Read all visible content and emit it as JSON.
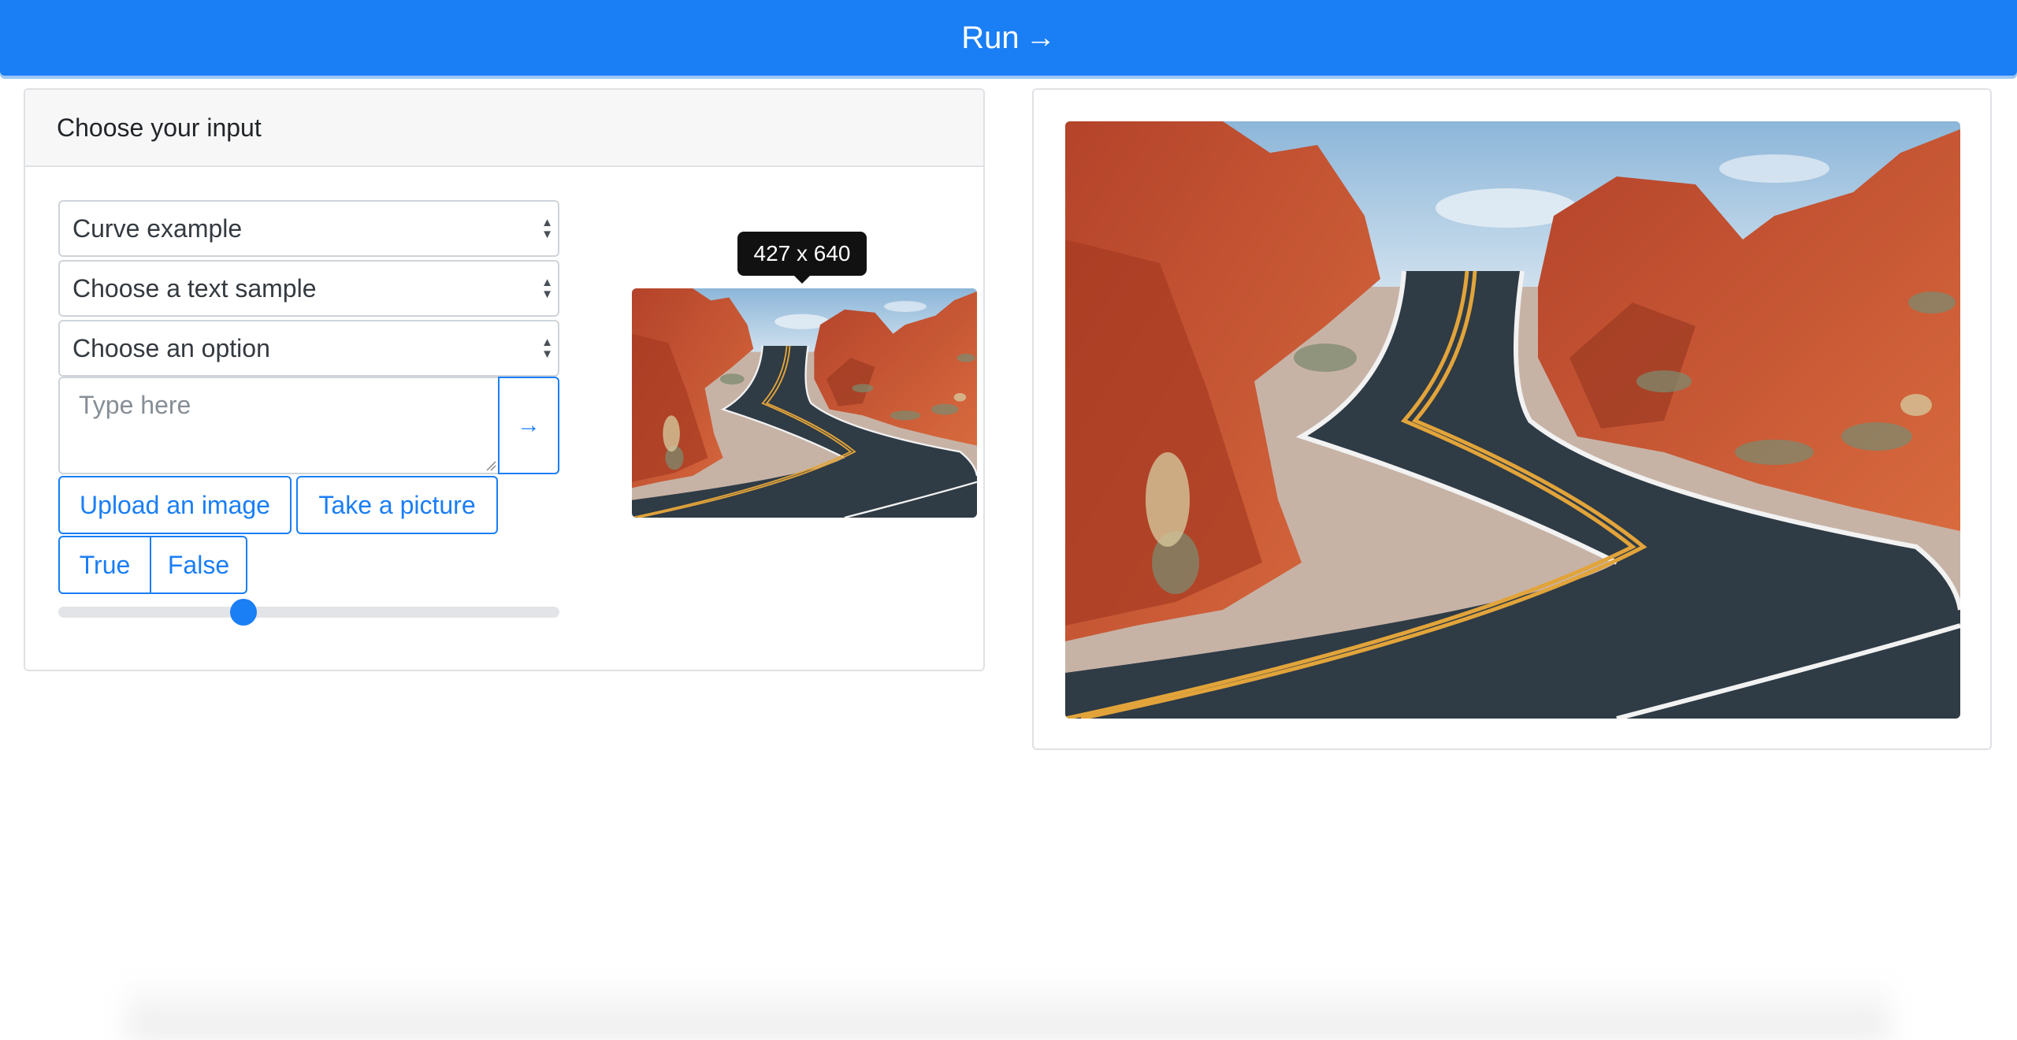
{
  "run_button": {
    "label": "Run",
    "arrow": "→"
  },
  "input_panel": {
    "header": "Choose your input",
    "selects": [
      {
        "value": "Curve example"
      },
      {
        "value": "Choose a text sample"
      },
      {
        "value": "Choose an option"
      }
    ],
    "textarea": {
      "placeholder": "Type here"
    },
    "submit_arrow": "→",
    "upload_button": "Upload an image",
    "picture_button": "Take a picture",
    "true_button": "True",
    "false_button": "False",
    "slider": {
      "value_fraction": 0.37
    },
    "tooltip": "427 x 640"
  },
  "images": {
    "thumbnail": "desert-road-photo",
    "output": "desert-road-photo"
  },
  "colors": {
    "accent": "#1a7ef5",
    "rock": "#c2502e",
    "road": "#2f3b45",
    "line": "#e2a43a",
    "sky": "#b9d4ea"
  }
}
